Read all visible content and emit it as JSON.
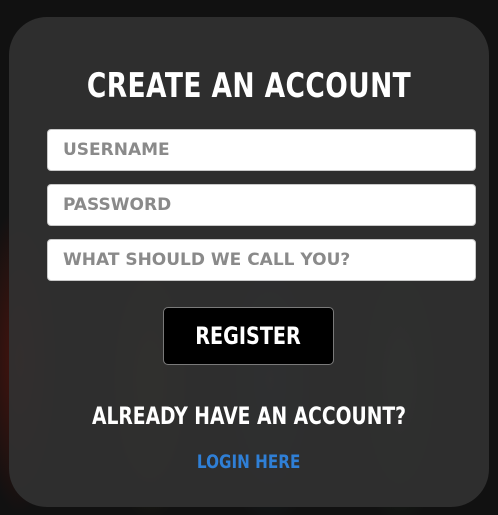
{
  "form": {
    "title": "CREATE AN ACCOUNT",
    "username_placeholder": "USERNAME",
    "password_placeholder": "PASSWORD",
    "nickname_placeholder": "WHAT SHOULD WE CALL YOU?",
    "register_label": "REGISTER",
    "already_text": "ALREADY HAVE AN ACCOUNT?",
    "login_link": "LOGIN HERE"
  },
  "colors": {
    "card": "#303030",
    "link": "#2f7fd6",
    "button": "#000000"
  }
}
